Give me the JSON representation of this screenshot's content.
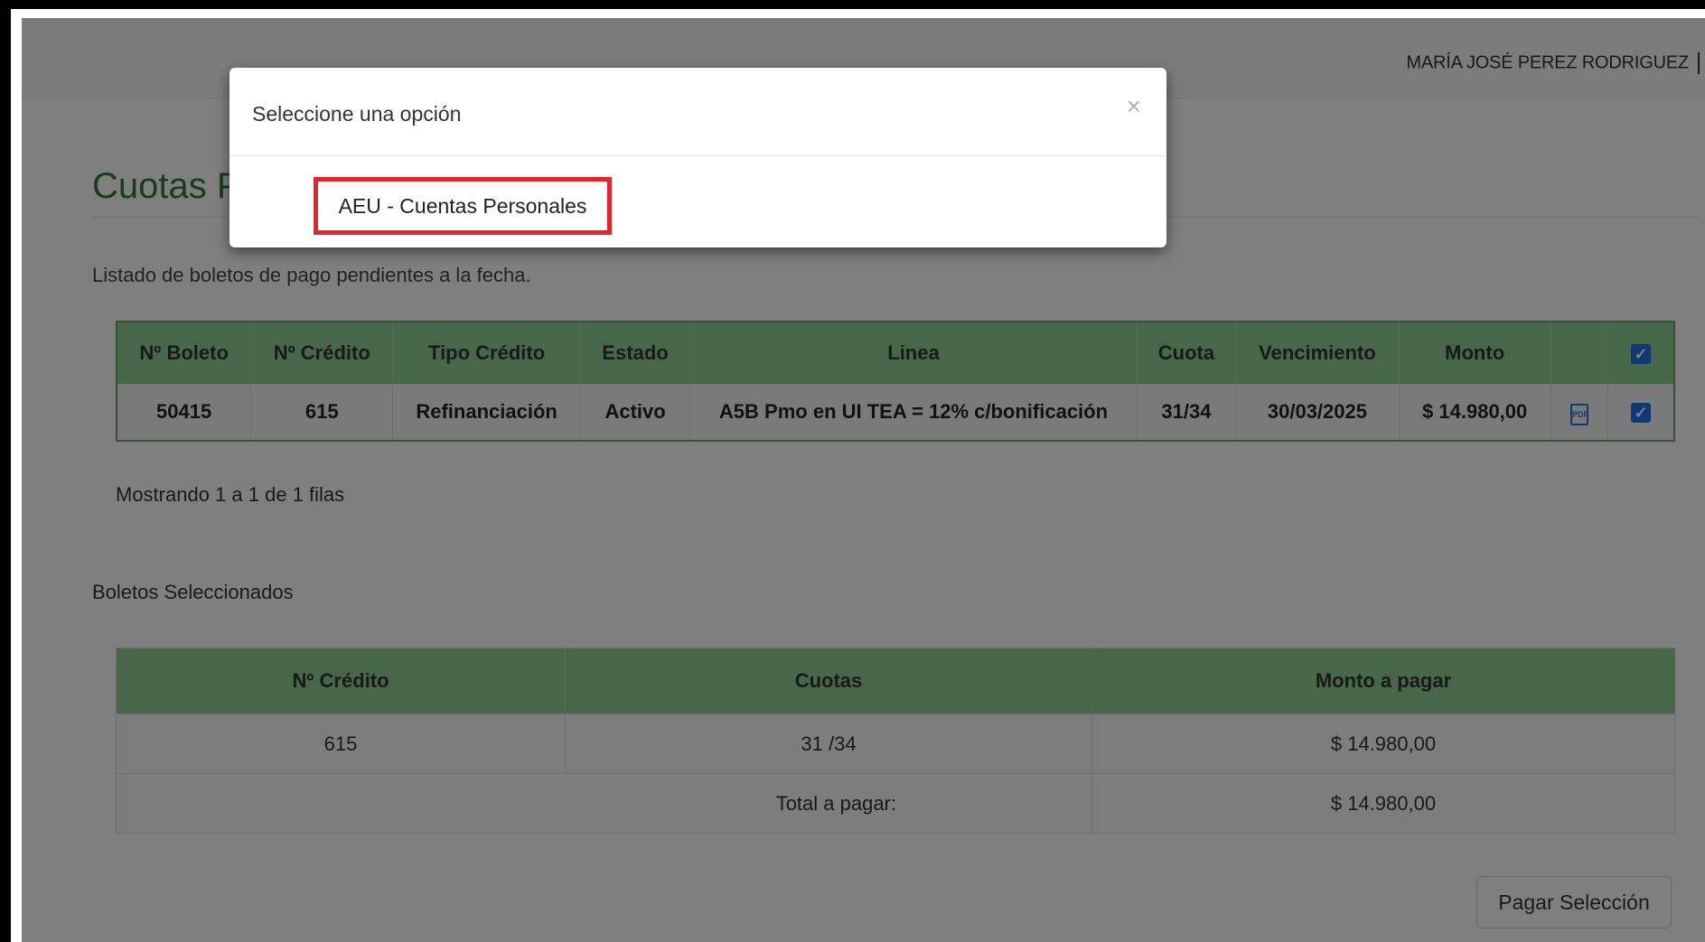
{
  "navbar": {
    "user_name": "MARÍA JOSÉ PEREZ RODRIGUEZ"
  },
  "page": {
    "title": "Cuotas P",
    "subtitle": "Listado de boletos de pago pendientes a la fecha."
  },
  "pending_table": {
    "headers": [
      "Nº Boleto",
      "Nº Crédito",
      "Tipo Crédito",
      "Estado",
      "Linea",
      "Cuota",
      "Vencimiento",
      "Monto"
    ],
    "rows": [
      {
        "boleto": "50415",
        "credito": "615",
        "tipo": "Refinanciación",
        "estado": "Activo",
        "linea": "A5B Pmo en UI TEA = 12% c/bonificación",
        "cuota": "31/34",
        "vencimiento": "30/03/2025",
        "monto": "$ 14.980,00",
        "checked": true
      }
    ],
    "header_checked": true,
    "pager": "Mostrando 1 a 1 de 1 filas"
  },
  "selected": {
    "title": "Boletos Seleccionados",
    "headers": [
      "Nº Crédito",
      "Cuotas",
      "Monto a pagar"
    ],
    "rows": [
      {
        "credito": "615",
        "cuotas": "31 /34",
        "monto": "$ 14.980,00"
      }
    ],
    "total_label": "Total a pagar:",
    "total_value": "$ 14.980,00"
  },
  "pay_button": "Pagar Selección",
  "modal": {
    "title": "Seleccione una opción",
    "close_symbol": "×",
    "option": "AEU - Cuentas Personales"
  },
  "colors": {
    "title_green": "#2e7d32",
    "table_header_green": "#8fcf93",
    "highlight_red": "#e8232a",
    "checkbox_blue": "#1a73e8"
  }
}
